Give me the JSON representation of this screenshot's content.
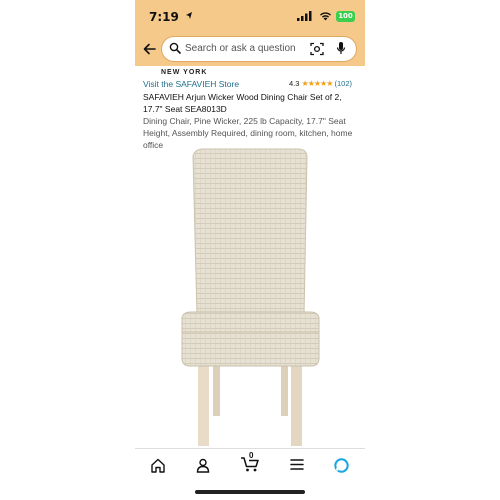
{
  "status": {
    "time": "7:19",
    "battery": "100"
  },
  "search": {
    "placeholder": "Search or ask a question"
  },
  "product": {
    "brand_label": "NEW YORK",
    "store_link": "Visit the SAFAVIEH Store",
    "rating_value": "4.3",
    "rating_stars": 4.3,
    "rating_count": "(102)",
    "title": "SAFAVIEH Arjun Wicker Wood Dining Chair Set of 2, 17.7\" Seat SEA8013D",
    "description": "Dining Chair, Pine Wicker, 225 lb Capacity, 17.7\" Seat Height, Assembly Required, dining room, kitchen, home office"
  },
  "tabbar": {
    "cart_count": "0",
    "items": [
      "home-icon",
      "account-icon",
      "cart-icon",
      "menu-icon",
      "alexa-icon"
    ]
  },
  "colors": {
    "header_bg": "#f5c98a",
    "link": "#1f6f8b",
    "star": "#f19f17"
  }
}
